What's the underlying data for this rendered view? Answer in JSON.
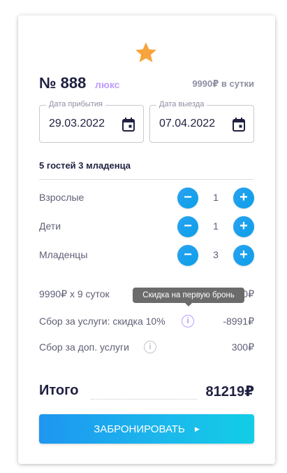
{
  "room": {
    "number": "№ 888",
    "type": "люкс",
    "price_per_day": "9990₽ в сутки"
  },
  "dates": {
    "arrival_label": "Дата прибытия",
    "arrival_value": "29.03.2022",
    "departure_label": "Дата выезда",
    "departure_value": "07.04.2022"
  },
  "guests": {
    "summary": "5 гостей 3 младенца",
    "rows": [
      {
        "label": "Взрослые",
        "count": "1"
      },
      {
        "label": "Дети",
        "count": "1"
      },
      {
        "label": "Младенцы",
        "count": "3"
      }
    ],
    "minus_symbol": "−",
    "plus_symbol": "+"
  },
  "costs": {
    "nights_label": "9990₽ х 9 суток",
    "nights_value": "0₽",
    "service_label": "Сбор за услуги: скидка 10%",
    "service_value": "-8991₽",
    "extra_label": "Сбор за доп. услуги",
    "extra_value": "300₽",
    "tooltip": "Скидка на первую бронь",
    "info_symbol": "i"
  },
  "total": {
    "label": "Итого",
    "value": "81219₽"
  },
  "book_button": {
    "label": "ЗАБРОНИРОВАТЬ",
    "arrow": "▶"
  },
  "colors": {
    "accent_purple": "#bc9cff",
    "button_blue": "#1e96f0",
    "star": "#f7a43d"
  },
  "icons": [
    "star-icon",
    "calendar-icon",
    "minus-icon",
    "plus-icon",
    "info-icon",
    "arrow-right-icon"
  ]
}
